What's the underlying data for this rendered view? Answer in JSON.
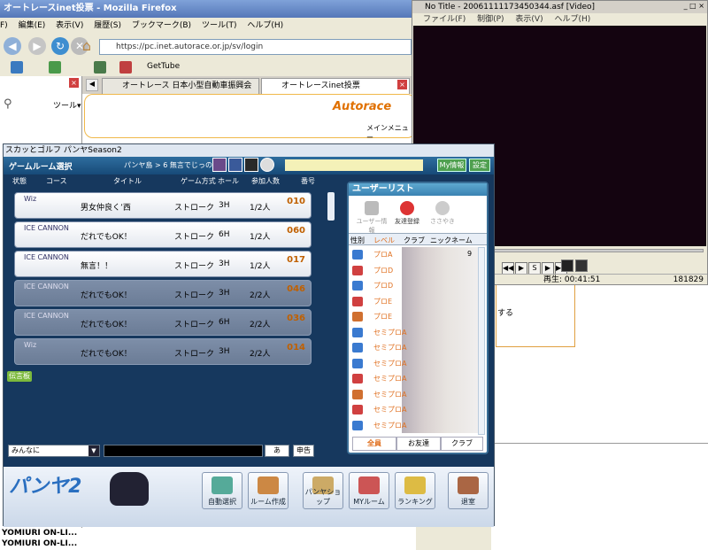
{
  "firefox": {
    "title": "オートレースinet投票 - Mozilla Firefox",
    "menu": [
      "F)",
      "編集(E)",
      "表示(V)",
      "履歴(S)",
      "ブックマーク(B)",
      "ツール(T)",
      "ヘルプ(H)"
    ],
    "url": "https://pc.inet.autorace.or.jp/sv/login",
    "bookmark": "GetTube",
    "sidebar_tools": "ツール▾",
    "tabs": [
      "オートレース 日本小型自動車振興会",
      "オートレースinet投票"
    ],
    "autorace_logo": "Autorace",
    "menu_text": "メインメニュー",
    "status_left": [
      "YOMIURI ON-LI...",
      "YOMIURI ON-LI..."
    ]
  },
  "video": {
    "title": "No Title - 20061111173450344.asf [Video]",
    "menu": [
      "ファイル(F)",
      "制御(P)",
      "表示(V)",
      "ヘルプ(H)"
    ],
    "status_play": "再生: 00:41:51",
    "status_right": "181829",
    "controls": [
      "◀◀",
      "▶",
      "S",
      "▶",
      "▶▶"
    ]
  },
  "page_fragment": "する",
  "game": {
    "title": "スカッとゴルフ パンヤSeason2",
    "section": "ゲームルーム選択",
    "location": "パンヤ島 > 6  無言でじっの",
    "my_info": "My情報",
    "settings": "設定",
    "headers": {
      "status": "状態",
      "course": "コース",
      "title": "タイトル",
      "mode": "ゲーム方式",
      "hole": "ホール",
      "players": "参加人数",
      "number": "番号"
    },
    "rooms": [
      {
        "title": "男女仲良く’西",
        "mode": "ストローク",
        "hole": "3H",
        "players": "1/2人",
        "number": "010",
        "course": "Wiz"
      },
      {
        "title": "だれでもOK！",
        "mode": "ストローク",
        "hole": "6H",
        "players": "1/2人",
        "number": "060",
        "course": "ICE CANNON"
      },
      {
        "title": "無言！！",
        "mode": "ストローク",
        "hole": "3H",
        "players": "1/2人",
        "number": "017",
        "course": "ICE CANNON"
      },
      {
        "title": "だれでもOK！",
        "mode": "ストローク",
        "hole": "3H",
        "players": "2/2人",
        "number": "046",
        "course": "ICE CANNON"
      },
      {
        "title": "だれでもOK！",
        "mode": "ストローク",
        "hole": "6H",
        "players": "2/2人",
        "number": "036",
        "course": "ICE CANNON"
      },
      {
        "title": "だれでもOK！",
        "mode": "ストローク",
        "hole": "3H",
        "players": "2/2人",
        "number": "014",
        "course": "Wiz"
      }
    ],
    "bbs": "伝言板",
    "userlist": {
      "title": "ユーザーリスト",
      "tools": [
        "ユーザー情報",
        "友達登録",
        "ささやき"
      ],
      "columns": [
        "性別",
        "レベル",
        "クラブ",
        "ニックネーム"
      ],
      "levels": [
        "プロA",
        "プロD",
        "プロD",
        "プロE",
        "プロE",
        "セミプロA",
        "セミプロA",
        "セミプロA",
        "セミプロA",
        "セミプロA",
        "セミプロA",
        "セミプロA"
      ],
      "first_row_extra": "9",
      "tabs": [
        "全員",
        "お友達",
        "クラブ"
      ]
    },
    "chat": {
      "target": "みんなに",
      "send": "申告",
      "ime": "あ"
    },
    "buttons": [
      "自動選択",
      "ルーム作成",
      "パンヤショップ",
      "MYルーム",
      "ランキング",
      "退室"
    ],
    "logo": "パンヤ2"
  }
}
